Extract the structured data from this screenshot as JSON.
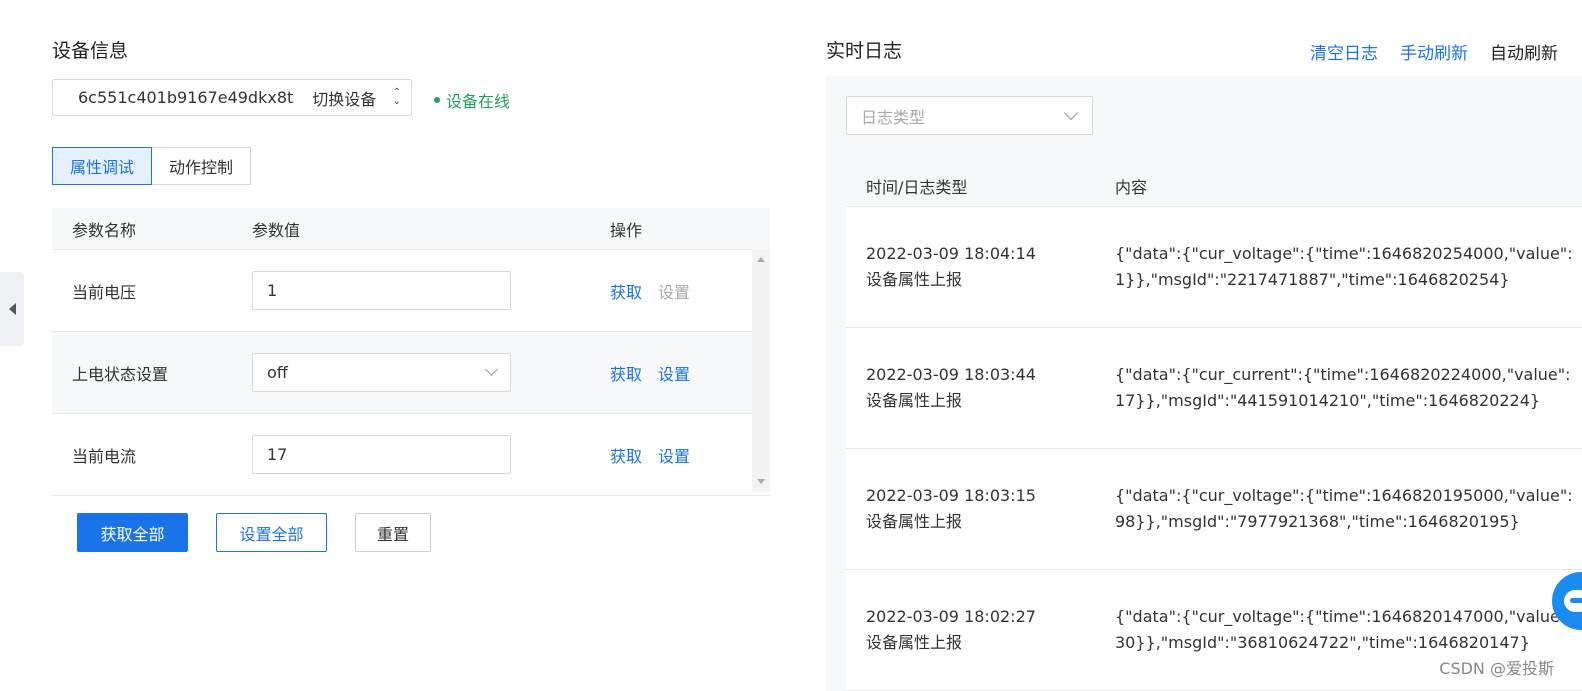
{
  "device_panel": {
    "title": "设备信息",
    "device_id": "6c551c401b9167e49dkx8t",
    "switch_label": "切换设备",
    "status": "设备在线",
    "tabs": [
      {
        "label": "属性调试",
        "active": true
      },
      {
        "label": "动作控制",
        "active": false
      }
    ],
    "table": {
      "columns": [
        "参数名称",
        "参数值",
        "操作"
      ],
      "rows": [
        {
          "name": "当前电压",
          "value": "1",
          "type": "input",
          "get": "获取",
          "set": "设置",
          "set_enabled": false
        },
        {
          "name": "上电状态设置",
          "value": "off",
          "type": "select",
          "get": "获取",
          "set": "设置",
          "set_enabled": true
        },
        {
          "name": "当前电流",
          "value": "17",
          "type": "input",
          "get": "获取",
          "set": "设置",
          "set_enabled": true
        }
      ]
    },
    "actions": {
      "get_all": "获取全部",
      "set_all": "设置全部",
      "reset": "重置"
    }
  },
  "log_panel": {
    "title": "实时日志",
    "links": {
      "clear": "清空日志",
      "manual_refresh": "手动刷新",
      "auto_refresh": "自动刷新"
    },
    "filter_placeholder": "日志类型",
    "columns": [
      "时间/日志类型",
      "内容"
    ],
    "rows": [
      {
        "time": "2022-03-09 18:04:14",
        "type": "设备属性上报",
        "content": "{\"data\":{\"cur_voltage\":{\"time\":1646820254000,\"value\":1}},\"msgId\":\"2217471887\",\"time\":1646820254}"
      },
      {
        "time": "2022-03-09 18:03:44",
        "type": "设备属性上报",
        "content": "{\"data\":{\"cur_current\":{\"time\":1646820224000,\"value\":17}},\"msgId\":\"441591014210\",\"time\":1646820224}"
      },
      {
        "time": "2022-03-09 18:03:15",
        "type": "设备属性上报",
        "content": "{\"data\":{\"cur_voltage\":{\"time\":1646820195000,\"value\":98}},\"msgId\":\"7977921368\",\"time\":1646820195}"
      },
      {
        "time": "2022-03-09 18:02:27",
        "type": "设备属性上报",
        "content": "{\"data\":{\"cur_voltage\":{\"time\":1646820147000,\"value\":30}},\"msgId\":\"36810624722\",\"time\":1646820147}"
      }
    ]
  },
  "watermark": "CSDN @爱投斯",
  "colors": {
    "accent": "#1a73e8",
    "online": "#20a162"
  }
}
